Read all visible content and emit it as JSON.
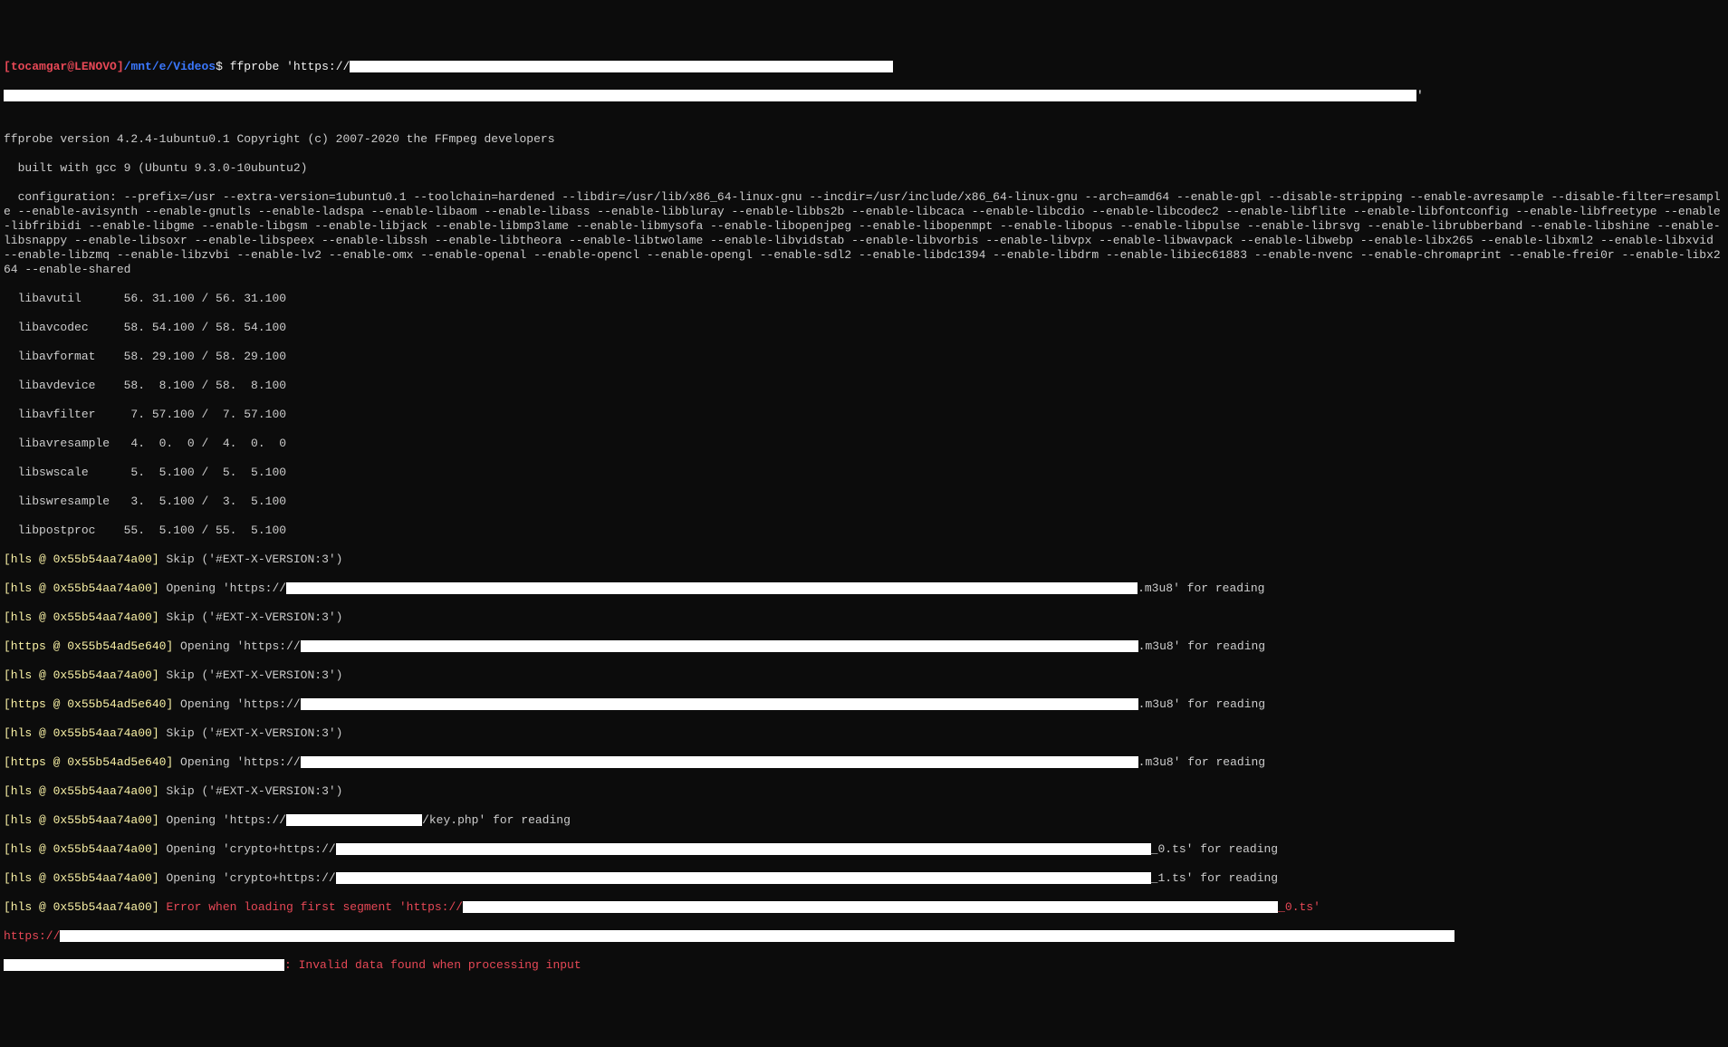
{
  "prompt": {
    "bracket_open": "[",
    "user_host": "tocamgar@LENOVO",
    "bracket_close": "]",
    "cwd": "/mnt/e/Videos",
    "dollar": "$ ",
    "cmd": "ffprobe 'https://",
    "cmd_end": "'"
  },
  "blank": "",
  "version_line": "ffprobe version 4.2.4-1ubuntu0.1 Copyright (c) 2007-2020 the FFmpeg developers",
  "built_line": "  built with gcc 9 (Ubuntu 9.3.0-10ubuntu2)",
  "config_line": "  configuration: --prefix=/usr --extra-version=1ubuntu0.1 --toolchain=hardened --libdir=/usr/lib/x86_64-linux-gnu --incdir=/usr/include/x86_64-linux-gnu --arch=amd64 --enable-gpl --disable-stripping --enable-avresample --disable-filter=resample --enable-avisynth --enable-gnutls --enable-ladspa --enable-libaom --enable-libass --enable-libbluray --enable-libbs2b --enable-libcaca --enable-libcdio --enable-libcodec2 --enable-libflite --enable-libfontconfig --enable-libfreetype --enable-libfribidi --enable-libgme --enable-libgsm --enable-libjack --enable-libmp3lame --enable-libmysofa --enable-libopenjpeg --enable-libopenmpt --enable-libopus --enable-libpulse --enable-librsvg --enable-librubberband --enable-libshine --enable-libsnappy --enable-libsoxr --enable-libspeex --enable-libssh --enable-libtheora --enable-libtwolame --enable-libvidstab --enable-libvorbis --enable-libvpx --enable-libwavpack --enable-libwebp --enable-libx265 --enable-libxml2 --enable-libxvid --enable-libzmq --enable-libzvbi --enable-lv2 --enable-omx --enable-openal --enable-opencl --enable-opengl --enable-sdl2 --enable-libdc1394 --enable-libdrm --enable-libiec61883 --enable-nvenc --enable-chromaprint --enable-frei0r --enable-libx264 --enable-shared",
  "libs": [
    "  libavutil      56. 31.100 / 56. 31.100",
    "  libavcodec     58. 54.100 / 58. 54.100",
    "  libavformat    58. 29.100 / 58. 29.100",
    "  libavdevice    58.  8.100 / 58.  8.100",
    "  libavfilter     7. 57.100 /  7. 57.100",
    "  libavresample   4.  0.  0 /  4.  0.  0",
    "  libswscale      5.  5.100 /  5.  5.100",
    "  libswresample   3.  5.100 /  3.  5.100",
    "  libpostproc    55.  5.100 / 55.  5.100"
  ],
  "hls_tag_open": "[hls @ 0x55b54aa74a00] ",
  "https_tag_open": "[https @ 0x55b54ad5e640] ",
  "skip_msg": "Skip ('#EXT-X-VERSION:3')",
  "open_https_prefix": "Opening 'https://",
  "open_crypto_prefix": "Opening 'crypto+https://",
  "m3u8_suffix": ".m3u8' for reading",
  "key_suffix": "/key.php' for reading",
  "ts0_suffix": "_0.ts' for reading",
  "ts1_suffix": "_1.ts' for reading",
  "error_prefix": "Error when loading first segment 'https://",
  "error_suffix": "_0.ts'",
  "final_https": "https://",
  "final_error": ": Invalid data found when processing input"
}
